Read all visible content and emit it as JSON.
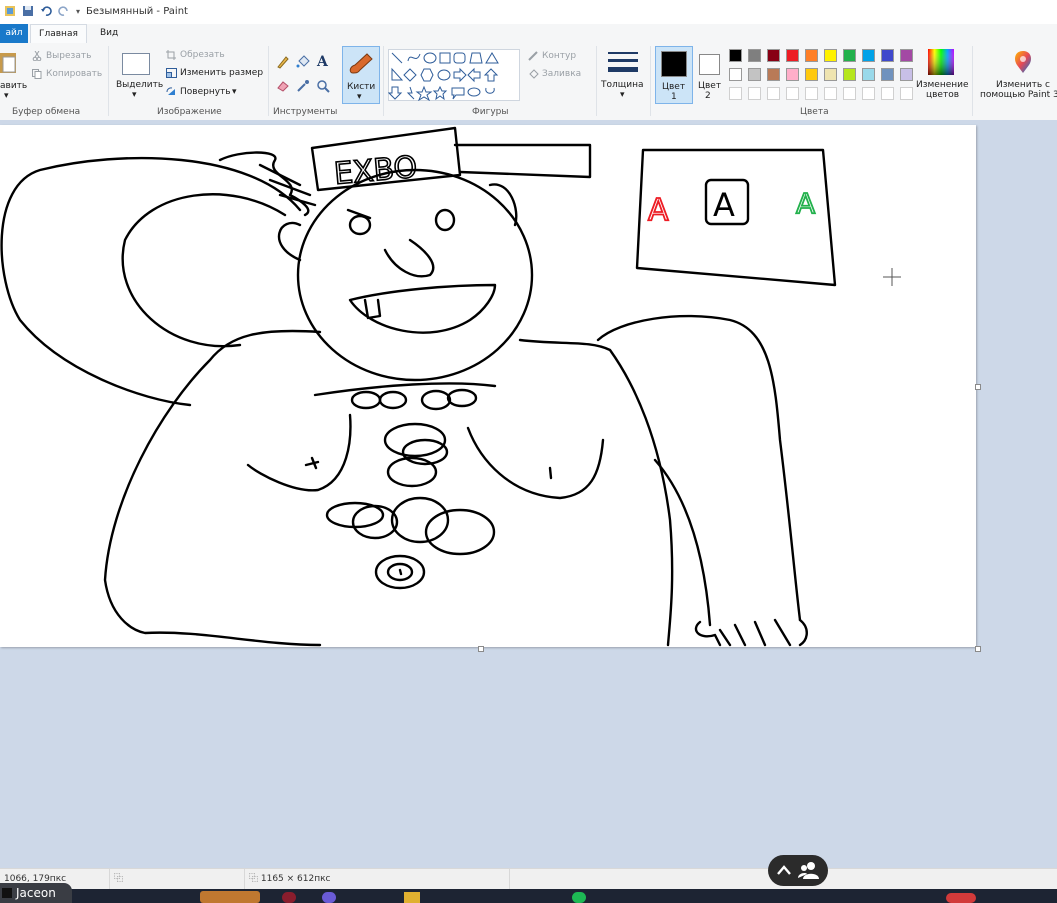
{
  "window": {
    "title": "Безымянный - Paint"
  },
  "menu": {
    "file": "айл",
    "tabs": [
      "Главная",
      "Вид"
    ]
  },
  "clipboard": {
    "paste": "авить",
    "cut": "Вырезать",
    "copy": "Копировать",
    "label": "Буфер обмена"
  },
  "image_group": {
    "select": "Выделить",
    "crop": "Обрезать",
    "resize": "Изменить размер",
    "rotate": "Повернуть",
    "label": "Изображение"
  },
  "tools_group": {
    "label": "Инструменты",
    "text_tool": "A"
  },
  "brushes": {
    "label": "Кисти"
  },
  "shapes_group": {
    "outline": "Контур",
    "fill": "Заливка",
    "label": "Фигуры"
  },
  "thickness": {
    "label": "Толщина"
  },
  "colors_group": {
    "color1_line1": "Цвет",
    "color1_line2": "1",
    "color2_line1": "Цвет",
    "color2_line2": "2",
    "edit_line1": "Изменение",
    "edit_line2": "цветов",
    "label": "Цвета",
    "color1_value": "#000000",
    "color2_value": "#ffffff",
    "palette_row1": [
      "#000000",
      "#7f7f7f",
      "#880015",
      "#ed1c24",
      "#ff7f27",
      "#fff200",
      "#22b14c",
      "#00a2e8",
      "#3f48cc",
      "#a349a4"
    ],
    "palette_row2": [
      "#ffffff",
      "#c3c3c3",
      "#b97a57",
      "#ffaec9",
      "#ffc90e",
      "#efe4b0",
      "#b5e61d",
      "#99d9ea",
      "#7092be",
      "#c8bfe7"
    ]
  },
  "paint3d": {
    "line1": "Изменить с",
    "line2": "помощью Paint 3"
  },
  "drawing": {
    "sign_text": "EXBO",
    "box_letters": [
      "A",
      "A",
      "A"
    ]
  },
  "status": {
    "cursor_pos": "1066, 179пкс",
    "canvas_size": "1165 × 612пкс"
  },
  "taskbar": {
    "user": "Jaceon"
  }
}
